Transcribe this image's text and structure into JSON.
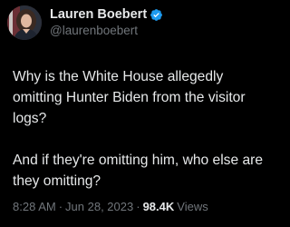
{
  "author": {
    "display_name": "Lauren Boebert",
    "handle": "@laurenboebert",
    "verified": true
  },
  "tweet": {
    "paragraphs": [
      "Why is the White House allegedly omitting Hunter Biden from the visitor logs?",
      "And if they're omitting him, who else are they omitting?"
    ]
  },
  "meta": {
    "time": "8:28 AM",
    "separator": "·",
    "date": "Jun 28, 2023",
    "views_count": "98.4K",
    "views_label": "Views"
  },
  "colors": {
    "background": "#000000",
    "text_primary": "#e7e9ea",
    "text_secondary": "#71767b",
    "verified_badge": "#1d9bf0"
  },
  "icons": {
    "verified": "verified-badge-icon"
  }
}
